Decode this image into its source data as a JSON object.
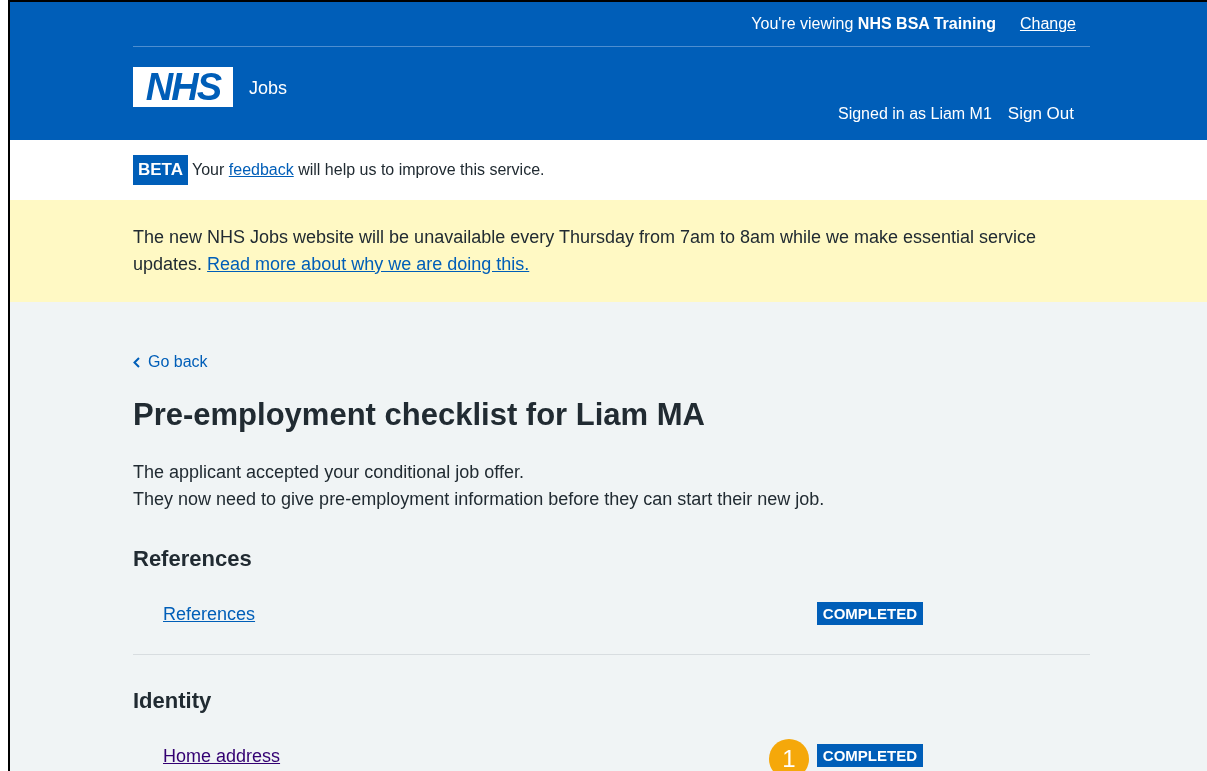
{
  "header": {
    "viewing_prefix": "You're viewing",
    "organisation": "NHS BSA Training",
    "change_link": "Change",
    "logo": "NHS",
    "service": "Jobs",
    "signed_in": "Signed in as Liam M1",
    "sign_out": "Sign Out"
  },
  "phase_banner": {
    "tag": "BETA",
    "before": "Your",
    "link": "feedback",
    "after": "will help us to improve this service."
  },
  "notice": {
    "text": "The new NHS Jobs website will be unavailable every Thursday from 7am to 8am while we make essential service updates.",
    "link": "Read more about why we are doing this."
  },
  "back_link": "Go back",
  "title": "Pre-employment checklist for Liam MA",
  "intro": [
    "The applicant accepted your conditional job offer.",
    "They now need to give pre-employment information before they can start their new job."
  ],
  "sections": [
    {
      "heading": "References",
      "items": [
        {
          "label": "References",
          "status": "COMPLETED",
          "visited": false
        }
      ]
    },
    {
      "heading": "Identity",
      "items": [
        {
          "label": "Home address",
          "status": "COMPLETED",
          "visited": true,
          "callout": "1"
        }
      ]
    }
  ]
}
